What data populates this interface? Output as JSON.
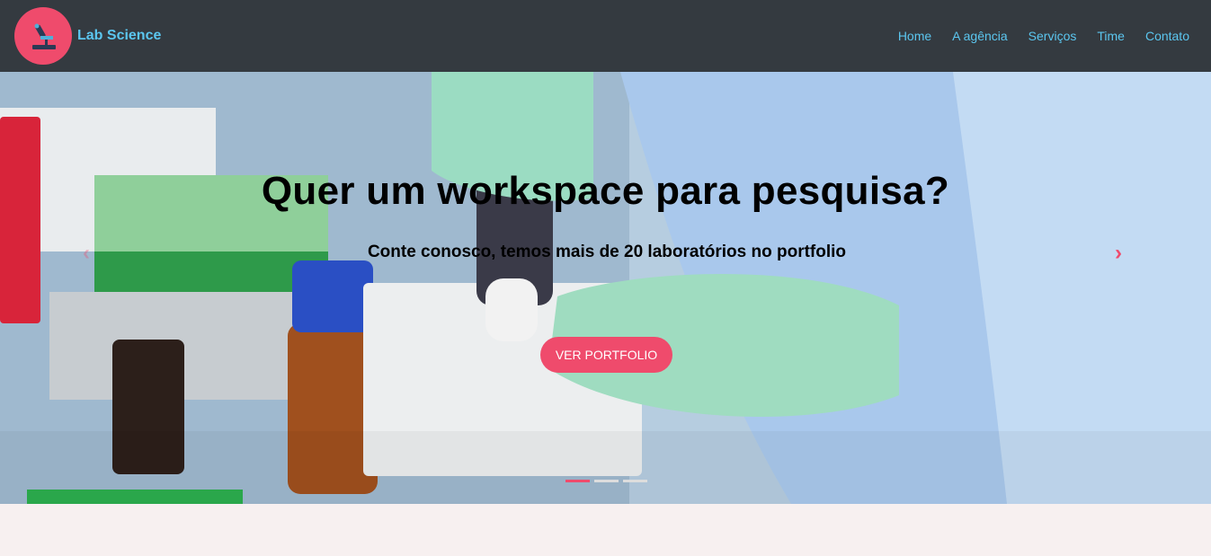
{
  "brand": {
    "name": "Lab Science",
    "logo_icon": "microscope-icon"
  },
  "nav": {
    "items": [
      {
        "label": "Home"
      },
      {
        "label": "A agência"
      },
      {
        "label": "Serviços"
      },
      {
        "label": "Time"
      },
      {
        "label": "Contato"
      }
    ]
  },
  "hero": {
    "title": "Quer um workspace para pesquisa?",
    "subtitle": "Conte conosco, temos mais de 20 laboratórios no portfolio",
    "cta_label": "VER PORTFOLIO",
    "prev_icon": "chevron-left-icon",
    "next_icon": "chevron-right-icon",
    "prev_glyph": "‹",
    "next_glyph": "›",
    "slide_count": 3,
    "active_slide": 1
  },
  "colors": {
    "navbar_bg": "#343a40",
    "nav_link": "#5bc6ef",
    "accent": "#ef4b6c",
    "page_bg": "#f7f0f0"
  }
}
